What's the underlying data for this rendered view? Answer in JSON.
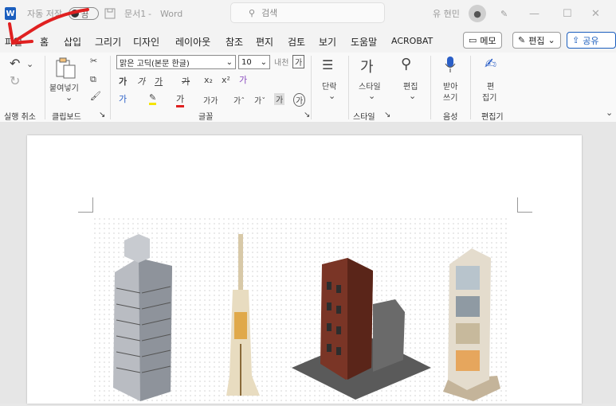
{
  "titlebar": {
    "autosave_label": "자동 저장",
    "autosave_state": "끔",
    "doc_name": "문서1",
    "app_name": "Word",
    "search_placeholder": "검색",
    "user_name": "유 현민"
  },
  "menu": [
    "파일",
    "홈",
    "삽입",
    "그리기",
    "디자인",
    "레이아웃",
    "참조",
    "편지",
    "검토",
    "보기",
    "도움말",
    "ACROBAT"
  ],
  "actions": {
    "memo": "메모",
    "edit": "편집",
    "share": "공유"
  },
  "ribbon": {
    "paste": "붙여넣기",
    "font_name": "맑은 고딕(본문 한글)",
    "font_size": "10",
    "paragraph": "단락",
    "style": "스타일",
    "edit": "편집",
    "dictate_line1": "받아",
    "dictate_line2": "쓰기",
    "editor_line1": "편",
    "editor_line2": "집기",
    "groups": {
      "undo": "실행 취소",
      "clipboard": "클립보드",
      "font": "글꼴",
      "style": "스타일",
      "voice": "음성",
      "editor": "편집기"
    }
  },
  "colors": {
    "brand": "#1b5ebe",
    "annotation": "#e02020"
  }
}
